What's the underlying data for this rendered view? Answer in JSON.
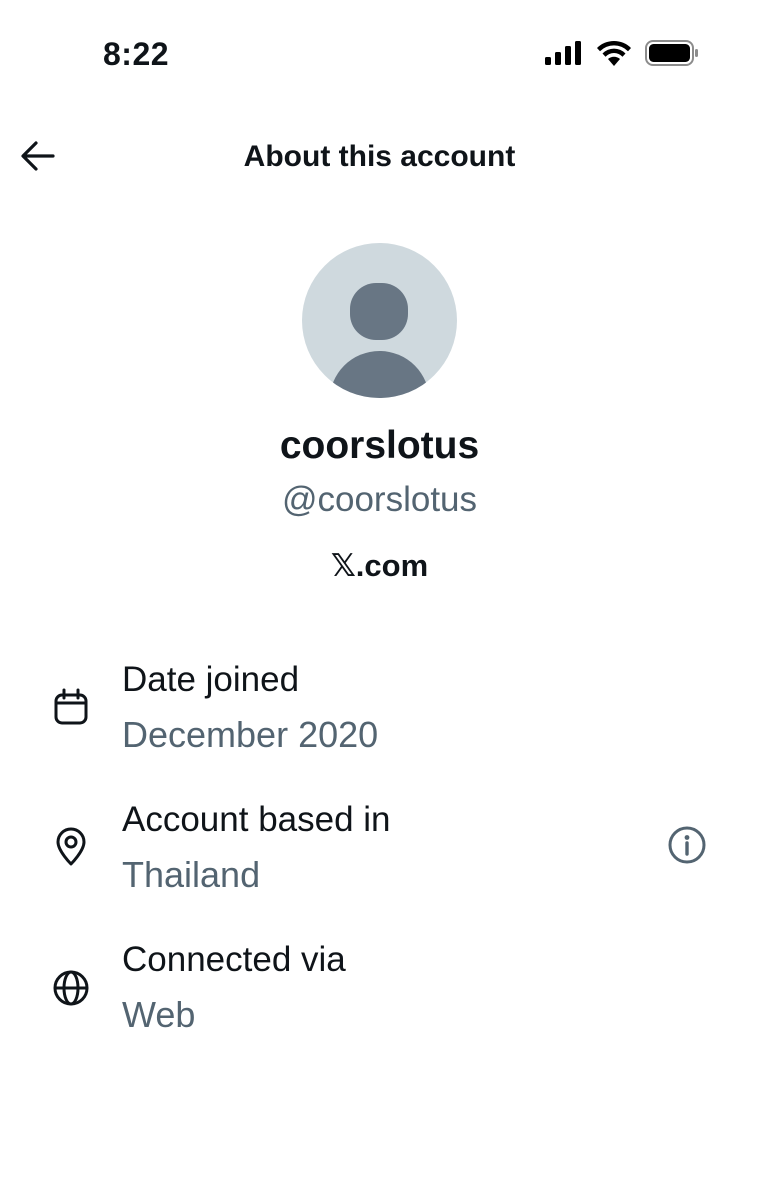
{
  "status_bar": {
    "time": "8:22",
    "icons": [
      "cellular-signal-icon",
      "wifi-icon",
      "battery-icon"
    ]
  },
  "header": {
    "title": "About this account",
    "back_icon": "arrow-left-icon"
  },
  "profile": {
    "display_name": "coorslotus",
    "handle": "@coorslotus",
    "site": "𝕏.com"
  },
  "details": [
    {
      "icon": "calendar-icon",
      "label": "Date joined",
      "value": "December 2020"
    },
    {
      "icon": "location-pin-icon",
      "label": "Account based in",
      "value": "Thailand",
      "action_icon": "info-icon"
    },
    {
      "icon": "globe-icon",
      "label": "Connected via",
      "value": "Web"
    }
  ],
  "colors": {
    "primary_text": "#0f1419",
    "secondary_text": "#536471",
    "avatar_bg": "#cfd9de",
    "avatar_fg": "#687684"
  }
}
